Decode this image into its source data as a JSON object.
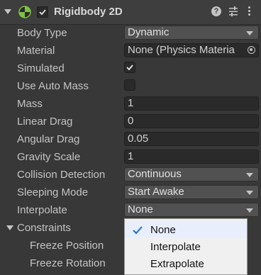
{
  "header": {
    "title": "Rigidbody 2D",
    "enabled": true,
    "icons": [
      "chevron-down-icon",
      "rigidbody2d-component-icon",
      "help-icon",
      "presets-icon",
      "context-menu-icon"
    ]
  },
  "properties": {
    "body_type": {
      "label": "Body Type",
      "value": "Dynamic"
    },
    "material": {
      "label": "Material",
      "value": "None (Physics Materia"
    },
    "simulated": {
      "label": "Simulated",
      "checked": true
    },
    "use_auto_mass": {
      "label": "Use Auto Mass",
      "checked": false
    },
    "mass": {
      "label": "Mass",
      "value": "1"
    },
    "linear_drag": {
      "label": "Linear Drag",
      "value": "0"
    },
    "angular_drag": {
      "label": "Angular Drag",
      "value": "0.05"
    },
    "gravity_scale": {
      "label": "Gravity Scale",
      "value": "1"
    },
    "collision_detection": {
      "label": "Collision Detection",
      "value": "Continuous"
    },
    "sleeping_mode": {
      "label": "Sleeping Mode",
      "value": "Start Awake"
    },
    "interpolate": {
      "label": "Interpolate",
      "value": "None"
    }
  },
  "constraints": {
    "label": "Constraints",
    "freeze_position": "Freeze Position",
    "freeze_rotation": "Freeze Rotation"
  },
  "interpolate_menu": {
    "options": [
      "None",
      "Interpolate",
      "Extrapolate"
    ],
    "selected": "None"
  },
  "colors": {
    "panel_bg": "#383838",
    "field_bg": "#2a2a2a",
    "dropdown_bg": "#515151",
    "text": "#c4c4c4",
    "popup_bg": "#f0f0f0",
    "check_blue": "#1a6fd0"
  }
}
